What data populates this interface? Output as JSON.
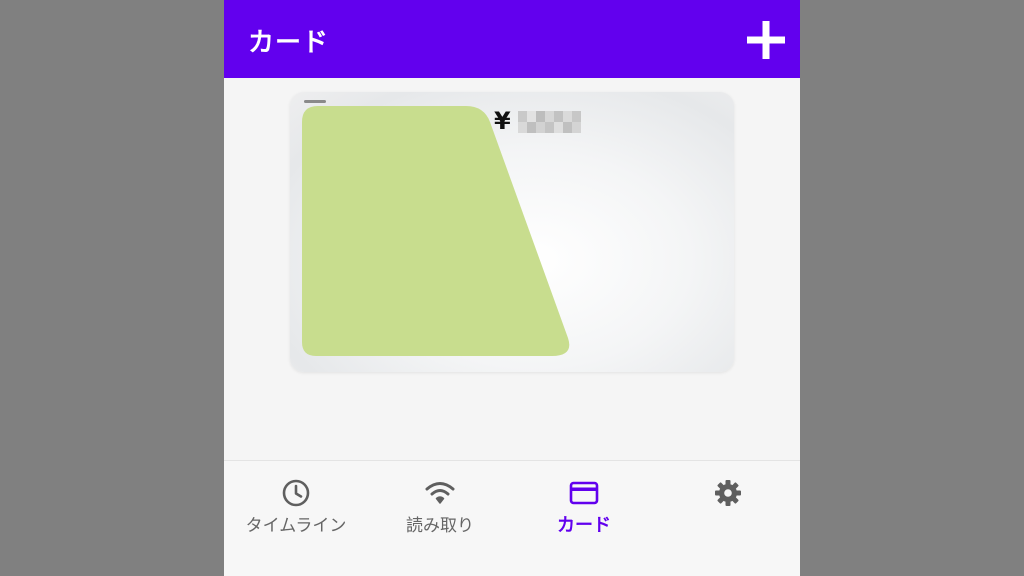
{
  "appbar": {
    "title": "カード",
    "add_icon": "plus-icon"
  },
  "card": {
    "balance_prefix": "¥",
    "balance_value_hidden": true,
    "card_color": "#c8dd8e"
  },
  "bottom_nav": {
    "items": [
      {
        "id": "timeline",
        "label": "タイムライン",
        "icon": "clock-icon",
        "active": false
      },
      {
        "id": "read",
        "label": "読み取り",
        "icon": "wifi-icon",
        "active": false
      },
      {
        "id": "card",
        "label": "カード",
        "icon": "credit-card-icon",
        "active": true
      },
      {
        "id": "settings",
        "label": "",
        "icon": "gear-icon",
        "active": false
      }
    ]
  },
  "colors": {
    "primary": "#6200ee",
    "inactive": "#666666",
    "background": "#f5f5f5",
    "letterbox": "#808080"
  }
}
